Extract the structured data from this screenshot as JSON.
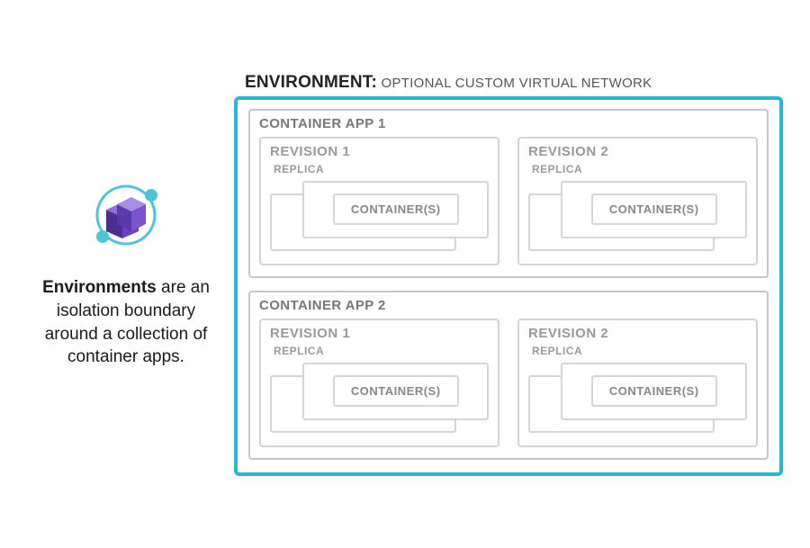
{
  "caption": {
    "bold": "Environments",
    "rest": " are an isolation boundary around a collection of container apps."
  },
  "environment": {
    "label_main": "ENVIRONMENT:",
    "label_sub": " OPTIONAL CUSTOM VIRTUAL NETWORK",
    "apps": [
      {
        "title": "CONTAINER APP 1",
        "revisions": [
          {
            "title": "REVISION 1",
            "replica_label": "REPLICA",
            "container_label": "CONTAINER(S)"
          },
          {
            "title": "REVISION 2",
            "replica_label": "REPLICA",
            "container_label": "CONTAINER(S)"
          }
        ]
      },
      {
        "title": "CONTAINER APP 2",
        "revisions": [
          {
            "title": "REVISION 1",
            "replica_label": "REPLICA",
            "container_label": "CONTAINER(S)"
          },
          {
            "title": "REVISION 2",
            "replica_label": "REPLICA",
            "container_label": "CONTAINER(S)"
          }
        ]
      }
    ]
  },
  "colors": {
    "environment_border": "#29b6d6",
    "box_border": "#c7c7c7",
    "inner_border": "#d6d6d6",
    "icon_primary": "#6b3fc4",
    "icon_accent": "#4fc3d8"
  }
}
